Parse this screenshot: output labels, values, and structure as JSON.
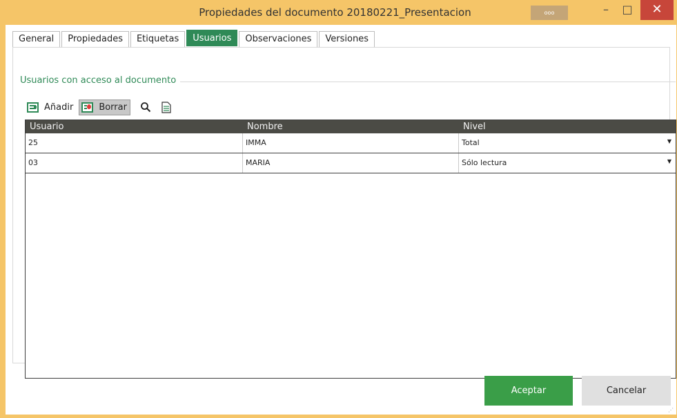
{
  "window": {
    "title": "Propiedades del documento 20180221_Presentacion",
    "dots_label": "ooo",
    "minimize_glyph": "–",
    "maximize_glyph": "□",
    "close_glyph": "✕"
  },
  "tabs": [
    {
      "label": "General",
      "active": false
    },
    {
      "label": "Propiedades",
      "active": false
    },
    {
      "label": "Etiquetas",
      "active": false
    },
    {
      "label": "Usuarios",
      "active": true
    },
    {
      "label": "Observaciones",
      "active": false
    },
    {
      "label": "Versiones",
      "active": false
    }
  ],
  "group": {
    "title": "Usuarios con acceso al documento"
  },
  "toolbar": {
    "add_label": "Añadir",
    "delete_label": "Borrar"
  },
  "grid": {
    "columns": [
      "Usuario",
      "Nombre",
      "Nivel"
    ],
    "rows": [
      {
        "usuario": "25",
        "nombre": "IMMA",
        "nivel": "Total"
      },
      {
        "usuario": "03",
        "nombre": "MARIA",
        "nivel": "Sólo lectura"
      }
    ]
  },
  "footer": {
    "ok_label": "Aceptar",
    "cancel_label": "Cancelar"
  },
  "colors": {
    "titlebar": "#f5c568",
    "accent_green": "#2f8a57",
    "ok_button": "#3a9e48",
    "grid_header": "#4b4b45",
    "close_button": "#c7463a"
  }
}
